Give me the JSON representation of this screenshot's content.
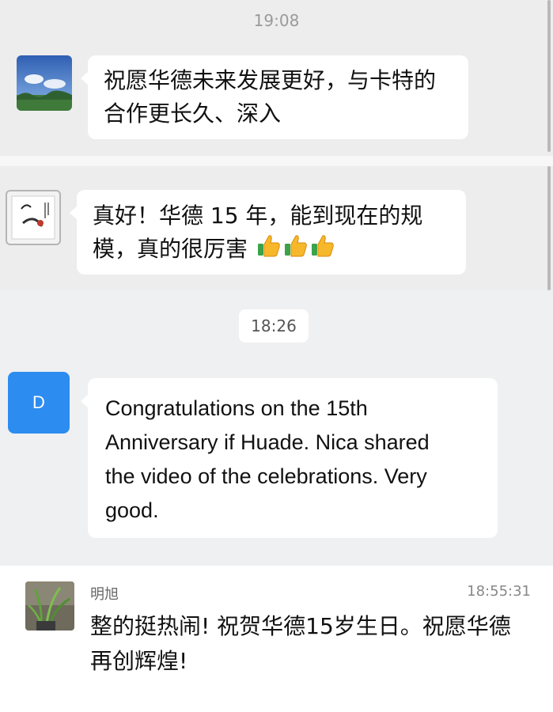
{
  "colors": {
    "background": "#ededed",
    "bubble": "#ffffff",
    "avatar_d": "#2d8cf0"
  },
  "timestamps": {
    "first": "19:08",
    "second": "18:26"
  },
  "messages": [
    {
      "avatar": "sky-landscape-avatar",
      "text_lines": [
        "祝愿华德未来发展更好，与卡特的",
        "合作更长久、深入"
      ]
    },
    {
      "avatar": "calligraphy-painting-avatar",
      "text_lines": [
        "真好！华德 15 年，能到现在的规",
        "模，真的很厉害"
      ],
      "emoji": [
        "thumbs-up-icon",
        "thumbs-up-icon",
        "thumbs-up-icon"
      ]
    },
    {
      "avatar": "letter-avatar",
      "avatar_letter": "D",
      "text_lines": [
        "Congratulations on the 15th",
        "Anniversary if Huade. Nica shared",
        "the video of the celebrations. Very",
        "good."
      ]
    }
  ],
  "comment": {
    "avatar": "plant-avatar",
    "sender": "明旭",
    "time": "18:55:31",
    "text_lines": [
      "整的挺热闹! 祝贺华德15岁生日。祝愿华德",
      "再创辉煌!"
    ]
  }
}
